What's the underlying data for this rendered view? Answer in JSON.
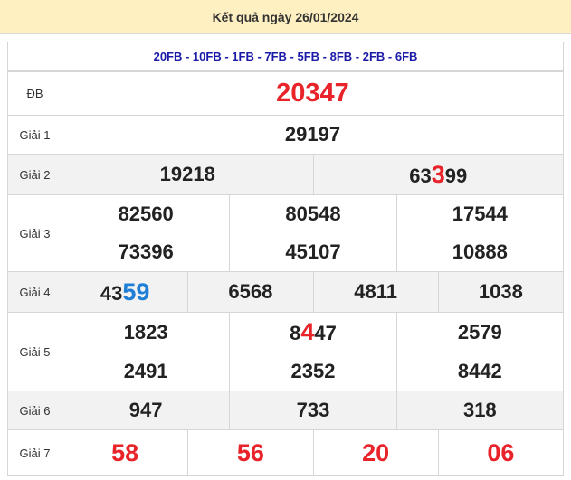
{
  "header": {
    "title": "Kết quả ngày 26/01/2024"
  },
  "codes": "20FB - 10FB - 1FB - 7FB - 5FB - 8FB - 2FB - 6FB",
  "prizes": {
    "db": {
      "label": "ĐB",
      "value": "20347"
    },
    "g1": {
      "label": "Giải 1",
      "value": "29197"
    },
    "g2": {
      "label": "Giải 2",
      "values": [
        "19218",
        "63399"
      ],
      "highlight": {
        "index": 1,
        "prefix": "63",
        "mark": "3",
        "suffix": "99"
      }
    },
    "g3": {
      "label": "Giải 3",
      "values": [
        "82560",
        "80548",
        "17544",
        "73396",
        "45107",
        "10888"
      ]
    },
    "g4": {
      "label": "Giải 4",
      "values": [
        "4359",
        "6568",
        "4811",
        "1038"
      ],
      "highlight": {
        "index": 0,
        "prefix": "43",
        "mark": "59",
        "suffix": ""
      }
    },
    "g5": {
      "label": "Giải 5",
      "values": [
        "1823",
        "8447",
        "2579",
        "2491",
        "2352",
        "8442"
      ],
      "highlight": {
        "index": 1,
        "prefix": "8",
        "mark": "4",
        "suffix": "47"
      }
    },
    "g6": {
      "label": "Giải 6",
      "values": [
        "947",
        "733",
        "318"
      ]
    },
    "g7": {
      "label": "Giải 7",
      "values": [
        "58",
        "56",
        "20",
        "06"
      ]
    }
  },
  "colors": {
    "header_bg": "#fff0c2",
    "code_text": "#1b1ba8",
    "red": "#e8232a",
    "blue": "#1f7fd6",
    "shade": "#f2f2f2"
  }
}
